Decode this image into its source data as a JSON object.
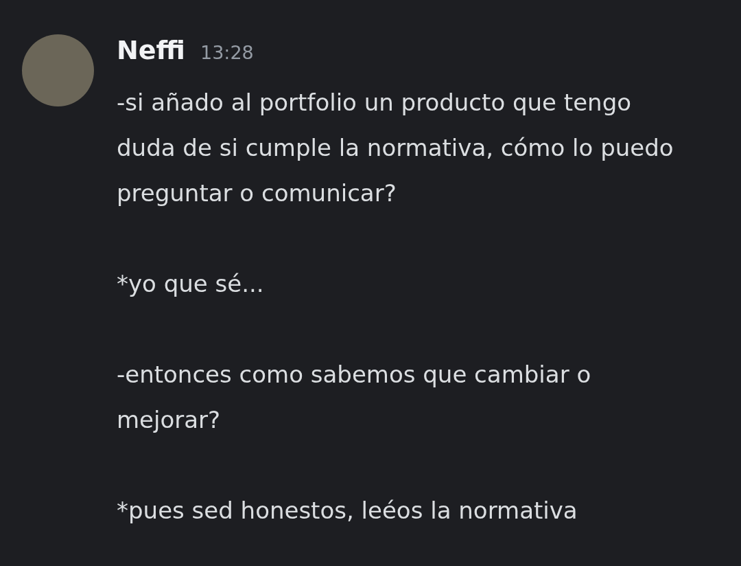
{
  "message": {
    "author": "Neffi",
    "time": "13:28",
    "paragraphs": [
      "-si añado al portfolio un producto que tengo duda de si cumple la normativa, cómo lo puedo preguntar o comunicar?",
      "*yo que sé...",
      "-entonces como sabemos que cambiar o mejorar?",
      "*pues sed honestos, leéos la normativa"
    ]
  }
}
